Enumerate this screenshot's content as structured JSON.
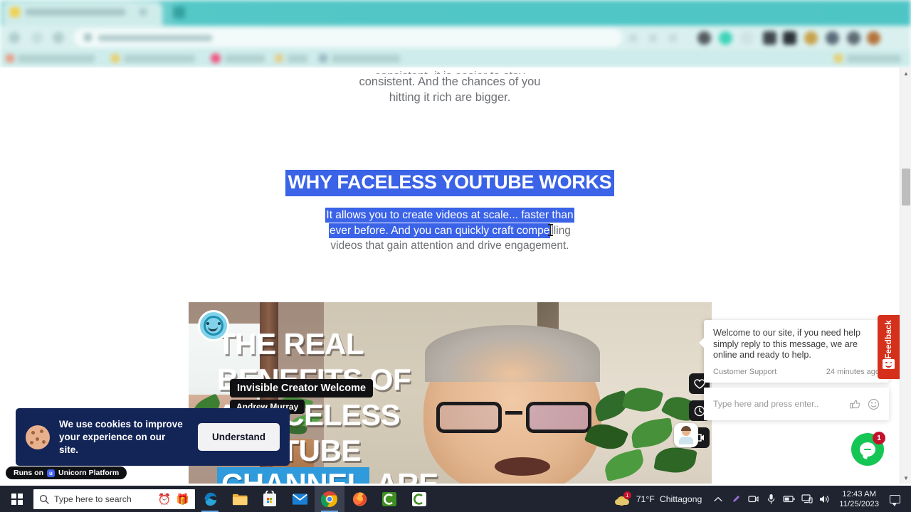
{
  "browser": {
    "tab_title": "",
    "address": ""
  },
  "page": {
    "para_top_clipped": "consistent, it is easier to stay",
    "para_top_line1": "consistent. And the chances of you",
    "para_top_line2": "hitting it rich are bigger.",
    "heading": "WHY FACELESS YOUTUBE WORKS",
    "sub_selected_1": "It allows you to create videos at scale... faster than",
    "sub_selected_2": "ever before. And you can quickly craft compe",
    "sub_rest_2": "lling",
    "sub_line3": "videos that gain attention and drive engagement.",
    "selection_color": "#3b63e8"
  },
  "video": {
    "pill_title": "Invisible Creator Welcome",
    "pill_author": "Andrew Murray",
    "title_lines": [
      "THE REAL",
      "BENEFITS OF",
      "A FACELESS",
      "YOUTUBE",
      "CHANNEL",
      " ARE"
    ],
    "actions": [
      "heart-icon",
      "clock-icon",
      "channel-icon"
    ]
  },
  "cookie_banner": {
    "message": "We use cookies to improve your experience on our site.",
    "button_label": "Understand",
    "background": "#132457"
  },
  "unicorn_badge": {
    "prefix": "Runs on",
    "brand": "Unicorn Platform",
    "mark": "u"
  },
  "chat": {
    "message": "Welcome to our site, if you need help simply reply to this message, we are online and ready to help.",
    "sender": "Customer Support",
    "timestamp": "24 minutes ago",
    "input_placeholder": "Type here and press enter..",
    "badge_count": "1",
    "fab_color": "#16c654",
    "badge_color": "#c4122c"
  },
  "feedback": {
    "label": "Feedback",
    "color": "#d4301c"
  },
  "scrollbar": {
    "up_arrow": "▲",
    "down_arrow": "▼"
  },
  "taskbar": {
    "search_placeholder": "Type here to search",
    "pinned_emoji": [
      "⏰",
      "🎁"
    ],
    "apps": [
      "edge-icon",
      "file-explorer-icon",
      "microsoft-store-icon",
      "mail-icon",
      "chrome-icon",
      "firefox-icon",
      "camtasia-icon",
      "camtasia-editor-icon"
    ],
    "weather_temp": "71°F",
    "weather_city": "Chittagong",
    "weather_badge": "1",
    "time": "12:43 AM",
    "date": "11/25/2023",
    "tray_icons": [
      "chevron-up-icon",
      "pen-icon",
      "camera-icon",
      "microphone-icon",
      "battery-icon",
      "display-icon",
      "volume-icon"
    ]
  }
}
